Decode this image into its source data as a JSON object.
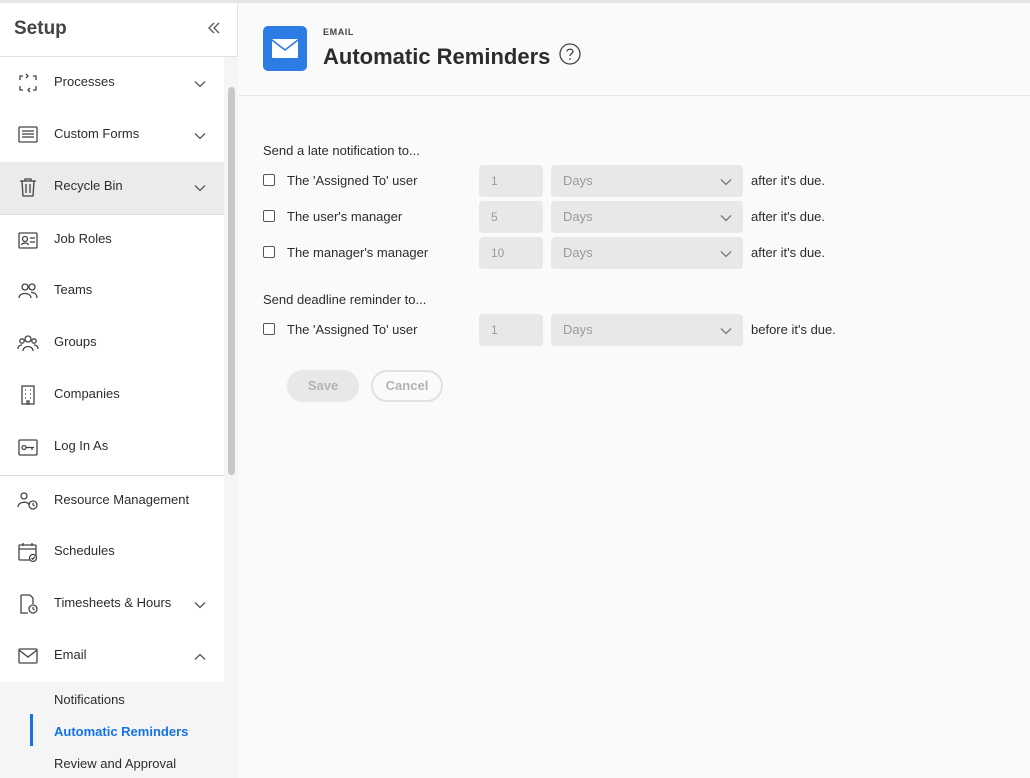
{
  "sidebar": {
    "title": "Setup",
    "items": [
      {
        "label": "Processes",
        "icon": "processes-icon",
        "expandable": true
      },
      {
        "label": "Custom Forms",
        "icon": "custom-forms-icon",
        "expandable": true
      },
      {
        "label": "Recycle Bin",
        "icon": "trash-icon",
        "expandable": true
      },
      {
        "label": "Job Roles",
        "icon": "job-roles-icon",
        "expandable": false
      },
      {
        "label": "Teams",
        "icon": "teams-icon",
        "expandable": false
      },
      {
        "label": "Groups",
        "icon": "groups-icon",
        "expandable": false
      },
      {
        "label": "Companies",
        "icon": "companies-icon",
        "expandable": false
      },
      {
        "label": "Log In As",
        "icon": "key-icon",
        "expandable": false
      },
      {
        "label": "Resource Management",
        "icon": "resource-management-icon",
        "expandable": false
      },
      {
        "label": "Schedules",
        "icon": "calendar-icon",
        "expandable": false
      },
      {
        "label": "Timesheets & Hours",
        "icon": "timesheets-icon",
        "expandable": true
      },
      {
        "label": "Email",
        "icon": "mail-icon",
        "expandable": true,
        "expanded": true
      }
    ],
    "email_subitems": [
      "Notifications",
      "Automatic Reminders",
      "Review and Approval"
    ]
  },
  "header": {
    "eyebrow": "EMAIL",
    "title": "Automatic Reminders"
  },
  "form": {
    "late_section": "Send a late notification to...",
    "late_rows": [
      {
        "label": "The 'Assigned To' user",
        "value": "1",
        "unit": "Days",
        "suffix": "after it's due."
      },
      {
        "label": "The user's manager",
        "value": "5",
        "unit": "Days",
        "suffix": "after it's due."
      },
      {
        "label": "The manager's manager",
        "value": "10",
        "unit": "Days",
        "suffix": "after it's due."
      }
    ],
    "deadline_section": "Send deadline reminder to...",
    "deadline_rows": [
      {
        "label": "The 'Assigned To' user",
        "value": "1",
        "unit": "Days",
        "suffix": "before it's due."
      }
    ],
    "save_label": "Save",
    "cancel_label": "Cancel"
  },
  "colors": {
    "accent": "#1473e6",
    "header_icon_bg": "#2d7be5",
    "active_item_bg": "#ebebeb"
  }
}
